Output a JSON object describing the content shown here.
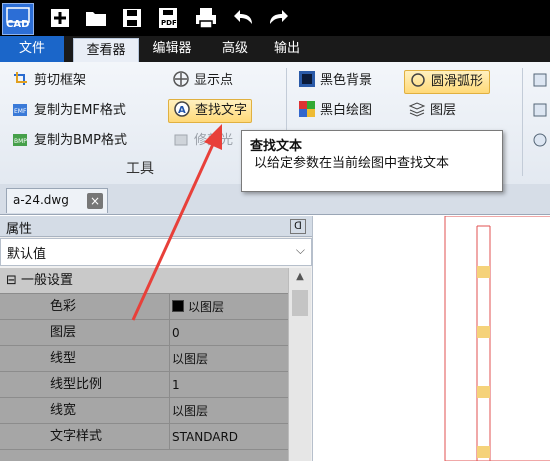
{
  "app": {
    "logo_text": "CAD"
  },
  "quick_toolbar": {
    "icons": [
      "cad-logo-icon",
      "new-file-icon",
      "open-folder-icon",
      "save-icon",
      "save-pdf-icon",
      "print-icon",
      "undo-icon",
      "redo-icon"
    ],
    "pdf_label": "PDF"
  },
  "menu": {
    "items": [
      "文件",
      "查看器",
      "编辑器",
      "高级",
      "输出"
    ],
    "active": "查看器"
  },
  "ribbon": {
    "tools_group": {
      "label": "工具",
      "items": [
        {
          "label": "剪切框架",
          "icon": "cut-frame-icon"
        },
        {
          "label": "复制为EMF格式",
          "icon": "copy-emf-icon"
        },
        {
          "label": "复制为BMP格式",
          "icon": "copy-bmp-icon"
        },
        {
          "label": "显示点",
          "icon": "show-points-icon"
        },
        {
          "label": "查找文字",
          "icon": "find-text-icon"
        },
        {
          "label": "修剪光",
          "icon": "trim-icon"
        }
      ]
    },
    "view_group": {
      "items": [
        {
          "label": "黑色背景",
          "icon": "black-bg-icon"
        },
        {
          "label": "黑白绘图",
          "icon": "bw-drawing-icon"
        },
        {
          "label": "圆滑弧形",
          "icon": "smooth-arc-icon"
        },
        {
          "label": "图层",
          "icon": "layers-icon"
        }
      ]
    }
  },
  "tooltip": {
    "title": "查找文本",
    "body": "以给定参数在当前绘图中查找文本"
  },
  "document_tab": {
    "label": "a-24.dwg",
    "close": "×"
  },
  "properties": {
    "header": "属性",
    "pin": "ᗡ",
    "dropdown_value": "默认值",
    "category": {
      "expander": "⊟",
      "label": "一般设置"
    },
    "rows": [
      {
        "name": "色彩",
        "value": "以图层",
        "swatch": "#000000"
      },
      {
        "name": "图层",
        "value": "0"
      },
      {
        "name": "线型",
        "value": "以图层"
      },
      {
        "name": "线型比例",
        "value": "1"
      },
      {
        "name": "线宽",
        "value": "以图层"
      },
      {
        "name": "文字样式",
        "value": "STANDARD"
      }
    ]
  },
  "colors": {
    "accent": "#1b66c9",
    "highlight": "#ffd978",
    "arrow": "#e8403a",
    "drawing_line": "#e05050"
  }
}
